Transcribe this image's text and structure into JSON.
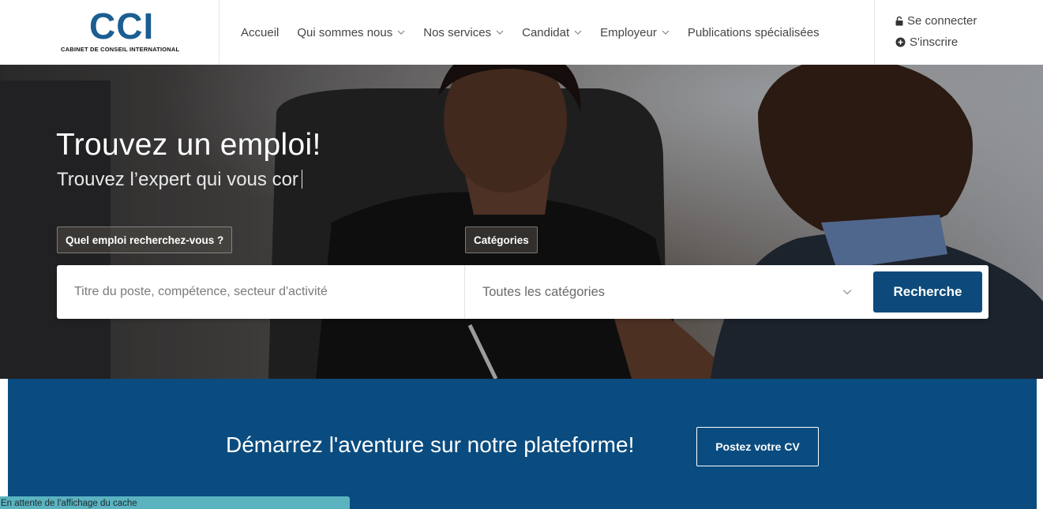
{
  "brand": {
    "logo_text": "CCI",
    "logo_subtitle": "CABINET DE CONSEIL INTERNATIONAL",
    "color": "#1a5e92"
  },
  "nav": {
    "items": [
      {
        "label": "Accueil",
        "dropdown": false
      },
      {
        "label": "Qui sommes nous",
        "dropdown": true
      },
      {
        "label": "Nos services",
        "dropdown": true
      },
      {
        "label": "Candidat",
        "dropdown": true
      },
      {
        "label": "Employeur",
        "dropdown": true
      },
      {
        "label": "Publications spécialisées",
        "dropdown": false
      }
    ]
  },
  "auth": {
    "login_label": "Se connecter",
    "login_icon": "lock-icon",
    "signup_label": "S'inscrire",
    "signup_icon": "plus-circle-icon"
  },
  "hero": {
    "title": "Trouvez un emploi!",
    "subtitle_typing": "Trouvez l’expert qui vous cor",
    "tag_query": "Quel emploi recherchez-vous ?",
    "tag_categories": "Catégories"
  },
  "search": {
    "placeholder": "Titre du poste, compétence, secteur d'activité",
    "category_value": "Toutes les catégories",
    "button_label": "Recherche",
    "button_color": "#0d4a7b"
  },
  "cta": {
    "text": "Démarrez l'aventure sur notre plateforme!",
    "button_label": "Postez votre CV",
    "background": "#0a4c7f"
  },
  "status_bar": {
    "text": "En attente de l'affichage du cache"
  }
}
